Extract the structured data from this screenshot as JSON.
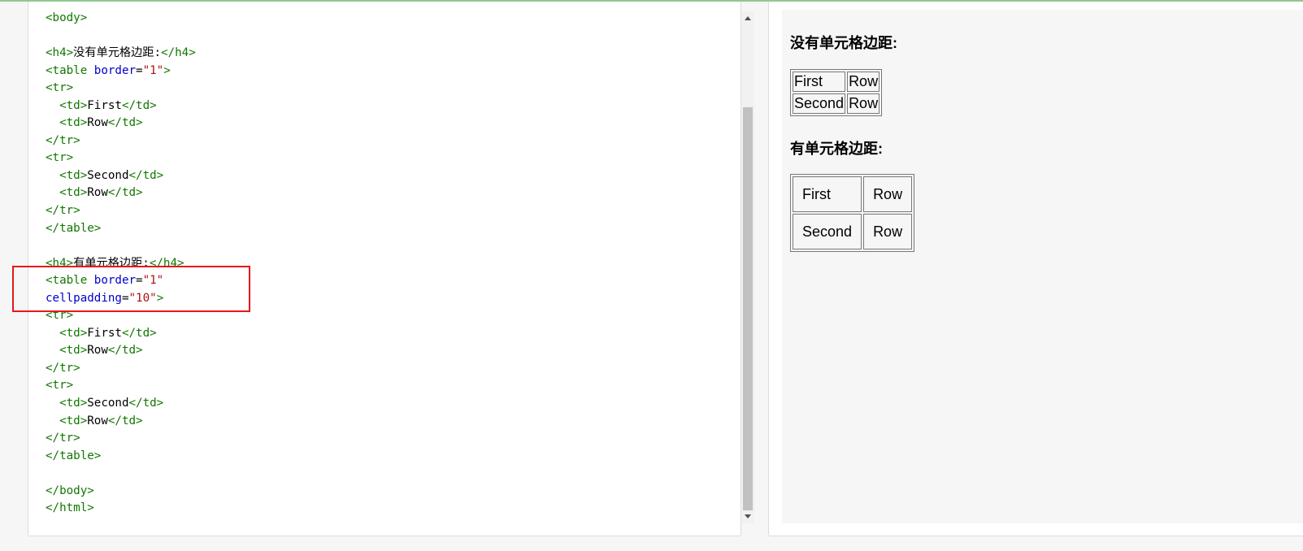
{
  "code_lines": [
    [
      {
        "c": "tag",
        "t": "<body>"
      }
    ],
    [],
    [
      {
        "c": "tag",
        "t": "<h4>"
      },
      {
        "c": "txt",
        "t": "没有单元格边距:"
      },
      {
        "c": "tag",
        "t": "</h4>"
      }
    ],
    [
      {
        "c": "tag",
        "t": "<table "
      },
      {
        "c": "attr",
        "t": "border"
      },
      {
        "c": "txt",
        "t": "="
      },
      {
        "c": "str",
        "t": "\"1\""
      },
      {
        "c": "tag",
        "t": ">"
      }
    ],
    [
      {
        "c": "tag",
        "t": "<tr>"
      }
    ],
    [
      {
        "c": "tag",
        "t": "  <td>"
      },
      {
        "c": "txt",
        "t": "First"
      },
      {
        "c": "tag",
        "t": "</td>"
      }
    ],
    [
      {
        "c": "tag",
        "t": "  <td>"
      },
      {
        "c": "txt",
        "t": "Row"
      },
      {
        "c": "tag",
        "t": "</td>"
      }
    ],
    [
      {
        "c": "tag",
        "t": "</tr>"
      }
    ],
    [
      {
        "c": "tag",
        "t": "<tr>"
      }
    ],
    [
      {
        "c": "tag",
        "t": "  <td>"
      },
      {
        "c": "txt",
        "t": "Second"
      },
      {
        "c": "tag",
        "t": "</td>"
      }
    ],
    [
      {
        "c": "tag",
        "t": "  <td>"
      },
      {
        "c": "txt",
        "t": "Row"
      },
      {
        "c": "tag",
        "t": "</td>"
      }
    ],
    [
      {
        "c": "tag",
        "t": "</tr>"
      }
    ],
    [
      {
        "c": "tag",
        "t": "</table>"
      }
    ],
    [],
    [
      {
        "c": "tag",
        "t": "<h4>"
      },
      {
        "c": "txt",
        "t": "有单元格边距:"
      },
      {
        "c": "tag",
        "t": "</h4>"
      }
    ],
    [
      {
        "c": "tag",
        "t": "<table "
      },
      {
        "c": "attr",
        "t": "border"
      },
      {
        "c": "txt",
        "t": "="
      },
      {
        "c": "str",
        "t": "\"1\""
      }
    ],
    [
      {
        "c": "attr",
        "t": "cellpadding"
      },
      {
        "c": "txt",
        "t": "="
      },
      {
        "c": "str",
        "t": "\"10\""
      },
      {
        "c": "tag",
        "t": ">"
      }
    ],
    [
      {
        "c": "tag",
        "t": "<tr>"
      }
    ],
    [
      {
        "c": "tag",
        "t": "  <td>"
      },
      {
        "c": "txt",
        "t": "First"
      },
      {
        "c": "tag",
        "t": "</td>"
      }
    ],
    [
      {
        "c": "tag",
        "t": "  <td>"
      },
      {
        "c": "txt",
        "t": "Row"
      },
      {
        "c": "tag",
        "t": "</td>"
      }
    ],
    [
      {
        "c": "tag",
        "t": "</tr>"
      }
    ],
    [
      {
        "c": "tag",
        "t": "<tr>"
      }
    ],
    [
      {
        "c": "tag",
        "t": "  <td>"
      },
      {
        "c": "txt",
        "t": "Second"
      },
      {
        "c": "tag",
        "t": "</td>"
      }
    ],
    [
      {
        "c": "tag",
        "t": "  <td>"
      },
      {
        "c": "txt",
        "t": "Row"
      },
      {
        "c": "tag",
        "t": "</td>"
      }
    ],
    [
      {
        "c": "tag",
        "t": "</tr>"
      }
    ],
    [
      {
        "c": "tag",
        "t": "</table>"
      }
    ],
    [],
    [
      {
        "c": "tag",
        "t": "</body>"
      }
    ],
    [
      {
        "c": "tag",
        "t": "</html>"
      }
    ]
  ],
  "syntax_colors": {
    "tag": "#117700",
    "attr": "#0000cc",
    "string": "#aa1111",
    "text": "#000000"
  },
  "highlight_color": "#e8161a",
  "preview": {
    "heading_no_padding": "没有单元格边距:",
    "heading_with_padding": "有单元格边距:",
    "table1": [
      [
        "First",
        "Row"
      ],
      [
        "Second",
        "Row"
      ]
    ],
    "table2": [
      [
        "First",
        "Row"
      ],
      [
        "Second",
        "Row"
      ]
    ]
  }
}
